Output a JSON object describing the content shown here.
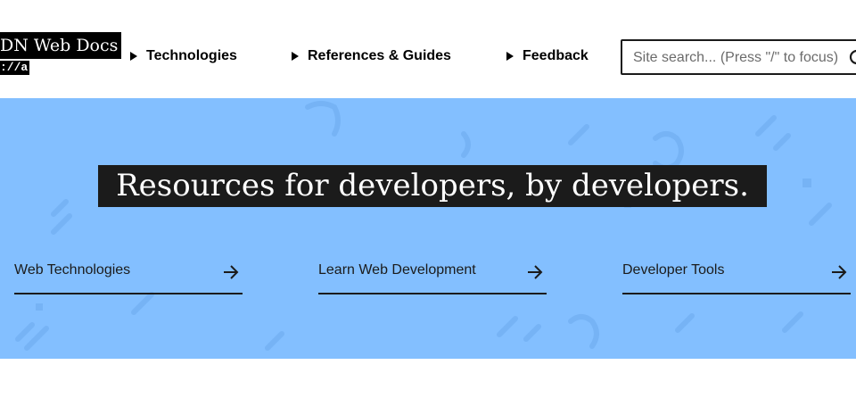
{
  "logo": {
    "main_text": "DN Web Docs",
    "sub_text": "://a"
  },
  "nav": {
    "items": [
      {
        "label": "Technologies"
      },
      {
        "label": "References & Guides"
      },
      {
        "label": "Feedback"
      }
    ]
  },
  "search": {
    "placeholder": "Site search... (Press \"/\" to focus)",
    "value": ""
  },
  "hero": {
    "title": "Resources for developers, by developers.",
    "links": [
      {
        "label": "Web Technologies"
      },
      {
        "label": "Learn Web Development"
      },
      {
        "label": "Developer Tools"
      }
    ]
  },
  "icons": {
    "search": "search-icon",
    "arrow": "arrow-right-icon",
    "disclosure": "triangle-right-icon"
  },
  "colors": {
    "hero_background": "#83bfff",
    "title_background": "#1b1b1b",
    "text": "#1b1b1b"
  }
}
